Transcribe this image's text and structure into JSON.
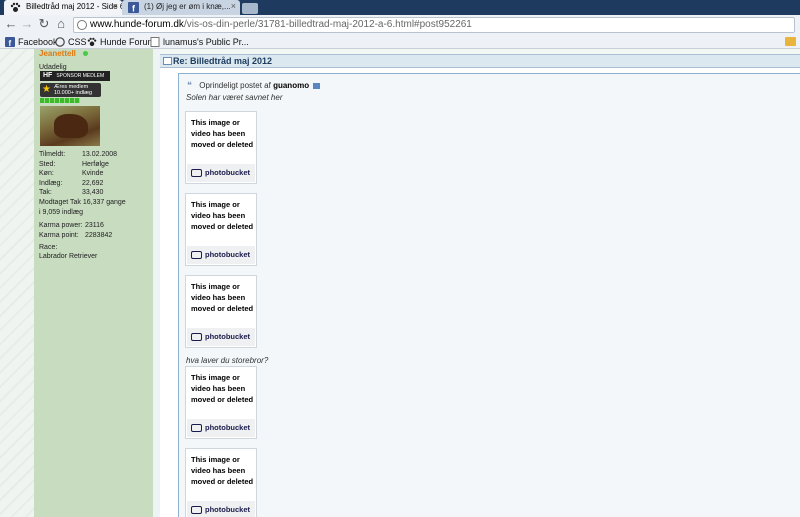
{
  "browser": {
    "tabs": [
      {
        "label": "Billedtråd maj 2012 - Side 6",
        "active": true,
        "icon": "paw-icon"
      },
      {
        "label": "(1) Øj jeg er øm i knæ,...",
        "active": false,
        "icon": "facebook-icon"
      }
    ],
    "url_host": "www.hunde-forum.dk",
    "url_path": "/vis-os-din-perle/31781-billedtrad-maj-2012-a-6.html#post952261",
    "bookmarks": [
      {
        "label": "Facebook",
        "icon": "facebook-icon"
      },
      {
        "label": "CSS",
        "icon": "css-icon"
      },
      {
        "label": "Hunde Forum",
        "icon": "paw-icon"
      },
      {
        "label": "lunamus's Public Pr...",
        "icon": "page-icon"
      }
    ]
  },
  "user": {
    "name": "Jeanettell",
    "status": "Udadelig",
    "badge_hf": "HF",
    "badge_hf_text": "SPONSOR MEDLEM",
    "badge_aeres_1": "Æres medlem",
    "badge_aeres_2": "10.000+ indlæg",
    "stats": [
      {
        "k": "Tilmeldt:",
        "v": "13.02.2008"
      },
      {
        "k": "Sted:",
        "v": "Herfølge"
      },
      {
        "k": "Køn:",
        "v": "Kvinde"
      },
      {
        "k": "Indlæg:",
        "v": "22,692"
      },
      {
        "k": "Tak:",
        "v": "33,430"
      }
    ],
    "modtaget_1": "Modtaget Tak 16,337 gange",
    "modtaget_2": "i 9,059 indlæg",
    "karma": [
      {
        "k": "Karma power:",
        "v": "23116"
      },
      {
        "k": "Karma point:",
        "v": "2283842"
      }
    ],
    "race_label": "Race:",
    "race_value": "Labrador Retriever"
  },
  "post": {
    "title": "Re: Billedtråd maj 2012",
    "quote_prefix": "Oprindeligt postet af",
    "quote_author": "guanomo",
    "quote_text": "Solen har været savnet her",
    "second_text": "hva laver du storebror?",
    "placeholder_text": "This image or video has been moved or deleted",
    "placeholder_logo": "photobucket"
  }
}
